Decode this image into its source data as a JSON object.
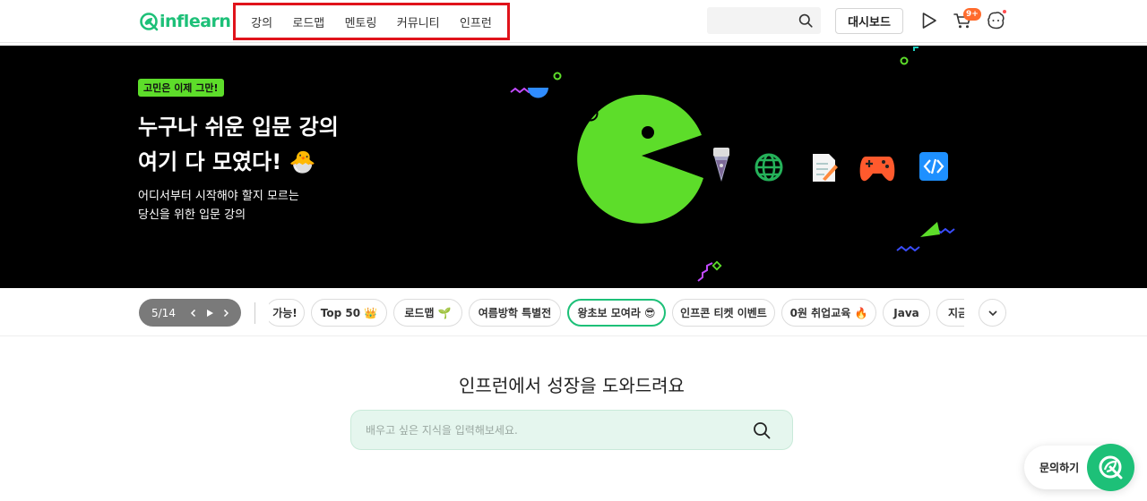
{
  "brand": {
    "logo_text": "inflearn",
    "color": "#1dc078"
  },
  "nav": {
    "items": [
      "강의",
      "로드맵",
      "멘토링",
      "커뮤니티",
      "인프런"
    ],
    "highlight_color": "#e0131b"
  },
  "header": {
    "search_placeholder": "",
    "dashboard_label": "대시보드",
    "cart_badge": "9+",
    "icons": [
      "search-icon",
      "play-icon",
      "cart-icon",
      "profile-icon"
    ]
  },
  "hero": {
    "badge": "고민은 이제 그만!",
    "title_line1": "누구나 쉬운 입문 강의",
    "title_line2": "여기 다 모였다! 🐣",
    "subtitle_line1": "어디서부터 시작해야 할지 모르는",
    "subtitle_line2": "당신을 위한 입문 강의",
    "accent_color": "#5ddd2a",
    "icons": [
      "pen-icon",
      "globe-icon",
      "memo-icon",
      "gamepad-icon",
      "code-icon"
    ]
  },
  "carousel": {
    "counter": "5/14",
    "chips": [
      "가능!",
      "Top 50 👑",
      "로드맵 🌱",
      "여름방학 특별전",
      "왕초보 모여라 😎",
      "인프콘 티켓 이벤트",
      "0원 취업교육 🔥",
      "Java",
      "지금"
    ],
    "active_index": 4
  },
  "main": {
    "heading": "인프런에서 성장을 도와드려요",
    "search_placeholder": "배우고 싶은 지식을 입력해보세요."
  },
  "help": {
    "label": "문의하기"
  }
}
